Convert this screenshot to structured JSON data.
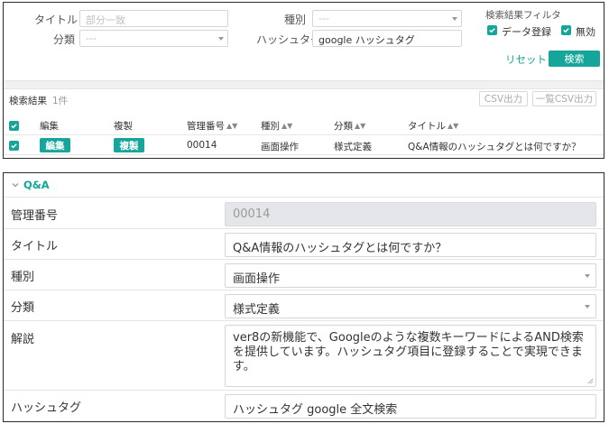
{
  "search": {
    "title_label": "タイトル",
    "title_placeholder": "部分一致",
    "type_label": "種別",
    "type_value": "---",
    "category_label": "分類",
    "category_value": "---",
    "hashtag_label": "ハッシュタグ",
    "hashtag_value": "google ハッシュタグ",
    "filter_title": "検索結果フィルタ",
    "filter_registered_label": "データ登録",
    "filter_disabled_label": "無効",
    "reset_label": "リセット",
    "search_button_label": "検索"
  },
  "results": {
    "title": "検索結果",
    "count": "1件",
    "csv_export_label": "CSV出力",
    "list_csv_export_label": "一覧CSV出力",
    "columns": [
      "編集",
      "複製",
      "管理番号",
      "種別",
      "分類",
      "タイトル"
    ],
    "sortable_columns": [
      false,
      false,
      true,
      true,
      true,
      true
    ],
    "rows": [
      {
        "edit_label": "編集",
        "copy_label": "複製",
        "id": "00014",
        "type": "画面操作",
        "category": "様式定義",
        "title": "Q&A情報のハッシュタグとは何ですか？"
      }
    ]
  },
  "detail": {
    "section_title": "Q&A",
    "id_label": "管理番号",
    "id_value": "00014",
    "title_label": "タイトル",
    "title_value": "Q&A情報のハッシュタグとは何ですか？",
    "type_label": "種別",
    "type_value": "画面操作",
    "category_label": "分類",
    "category_value": "様式定義",
    "description_label": "解説",
    "description_value": "ver8の新機能で、Googleのような複数キーワードによるAND検索を提供しています。ハッシュタグ項目に登録することで実現できます。",
    "hashtag_label": "ハッシュタグ",
    "hashtag_value": "ハッシュタグ google 全文検索"
  },
  "colors": {
    "accent": "#16a59a",
    "readonly_bg": "#e4e6e9",
    "border": "#d6d6d6"
  },
  "icons": [
    "check-icon",
    "chevron-down-icon",
    "sort-icon",
    "caret-down-icon",
    "resize-grip-icon"
  ]
}
